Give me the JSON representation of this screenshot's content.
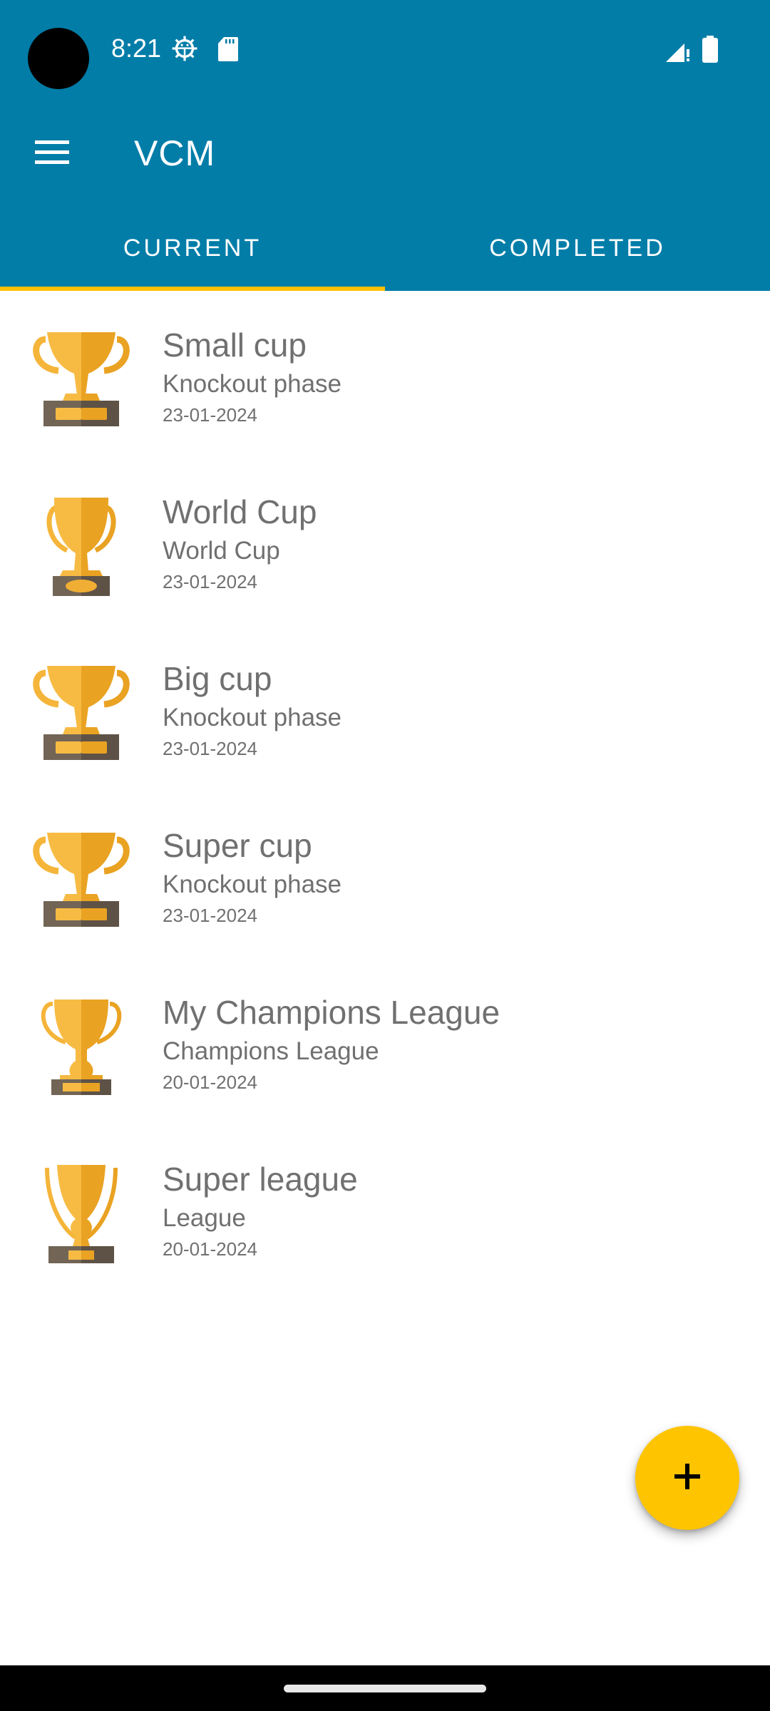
{
  "status_bar": {
    "time": "8:21",
    "left_icons": [
      "debug-gear-icon",
      "sd-card-icon"
    ],
    "right_icons": [
      "signal-no-data-icon",
      "battery-icon"
    ]
  },
  "app_bar": {
    "title": "VCM",
    "menu_icon": "hamburger-menu-icon",
    "color": "#017DA8"
  },
  "tabs": [
    {
      "label": "CURRENT",
      "selected": true
    },
    {
      "label": "COMPLETED",
      "selected": false
    }
  ],
  "tab_indicator_color": "#FFC107",
  "competitions": [
    {
      "name": "Small cup",
      "type": "Knockout phase",
      "date": "23-01-2024",
      "icon": "trophy-cup-icon"
    },
    {
      "name": "World Cup",
      "type": "World Cup",
      "date": "23-01-2024",
      "icon": "trophy-world-cup-icon"
    },
    {
      "name": "Big cup",
      "type": "Knockout phase",
      "date": "23-01-2024",
      "icon": "trophy-cup-icon"
    },
    {
      "name": "Super cup",
      "type": "Knockout phase",
      "date": "23-01-2024",
      "icon": "trophy-cup-icon"
    },
    {
      "name": "My Champions League",
      "type": "Champions League",
      "date": "20-01-2024",
      "icon": "trophy-champions-league-icon"
    },
    {
      "name": "Super league",
      "type": "League",
      "date": "20-01-2024",
      "icon": "trophy-league-icon"
    }
  ],
  "fab": {
    "icon": "plus-icon",
    "color": "#FFC400"
  }
}
